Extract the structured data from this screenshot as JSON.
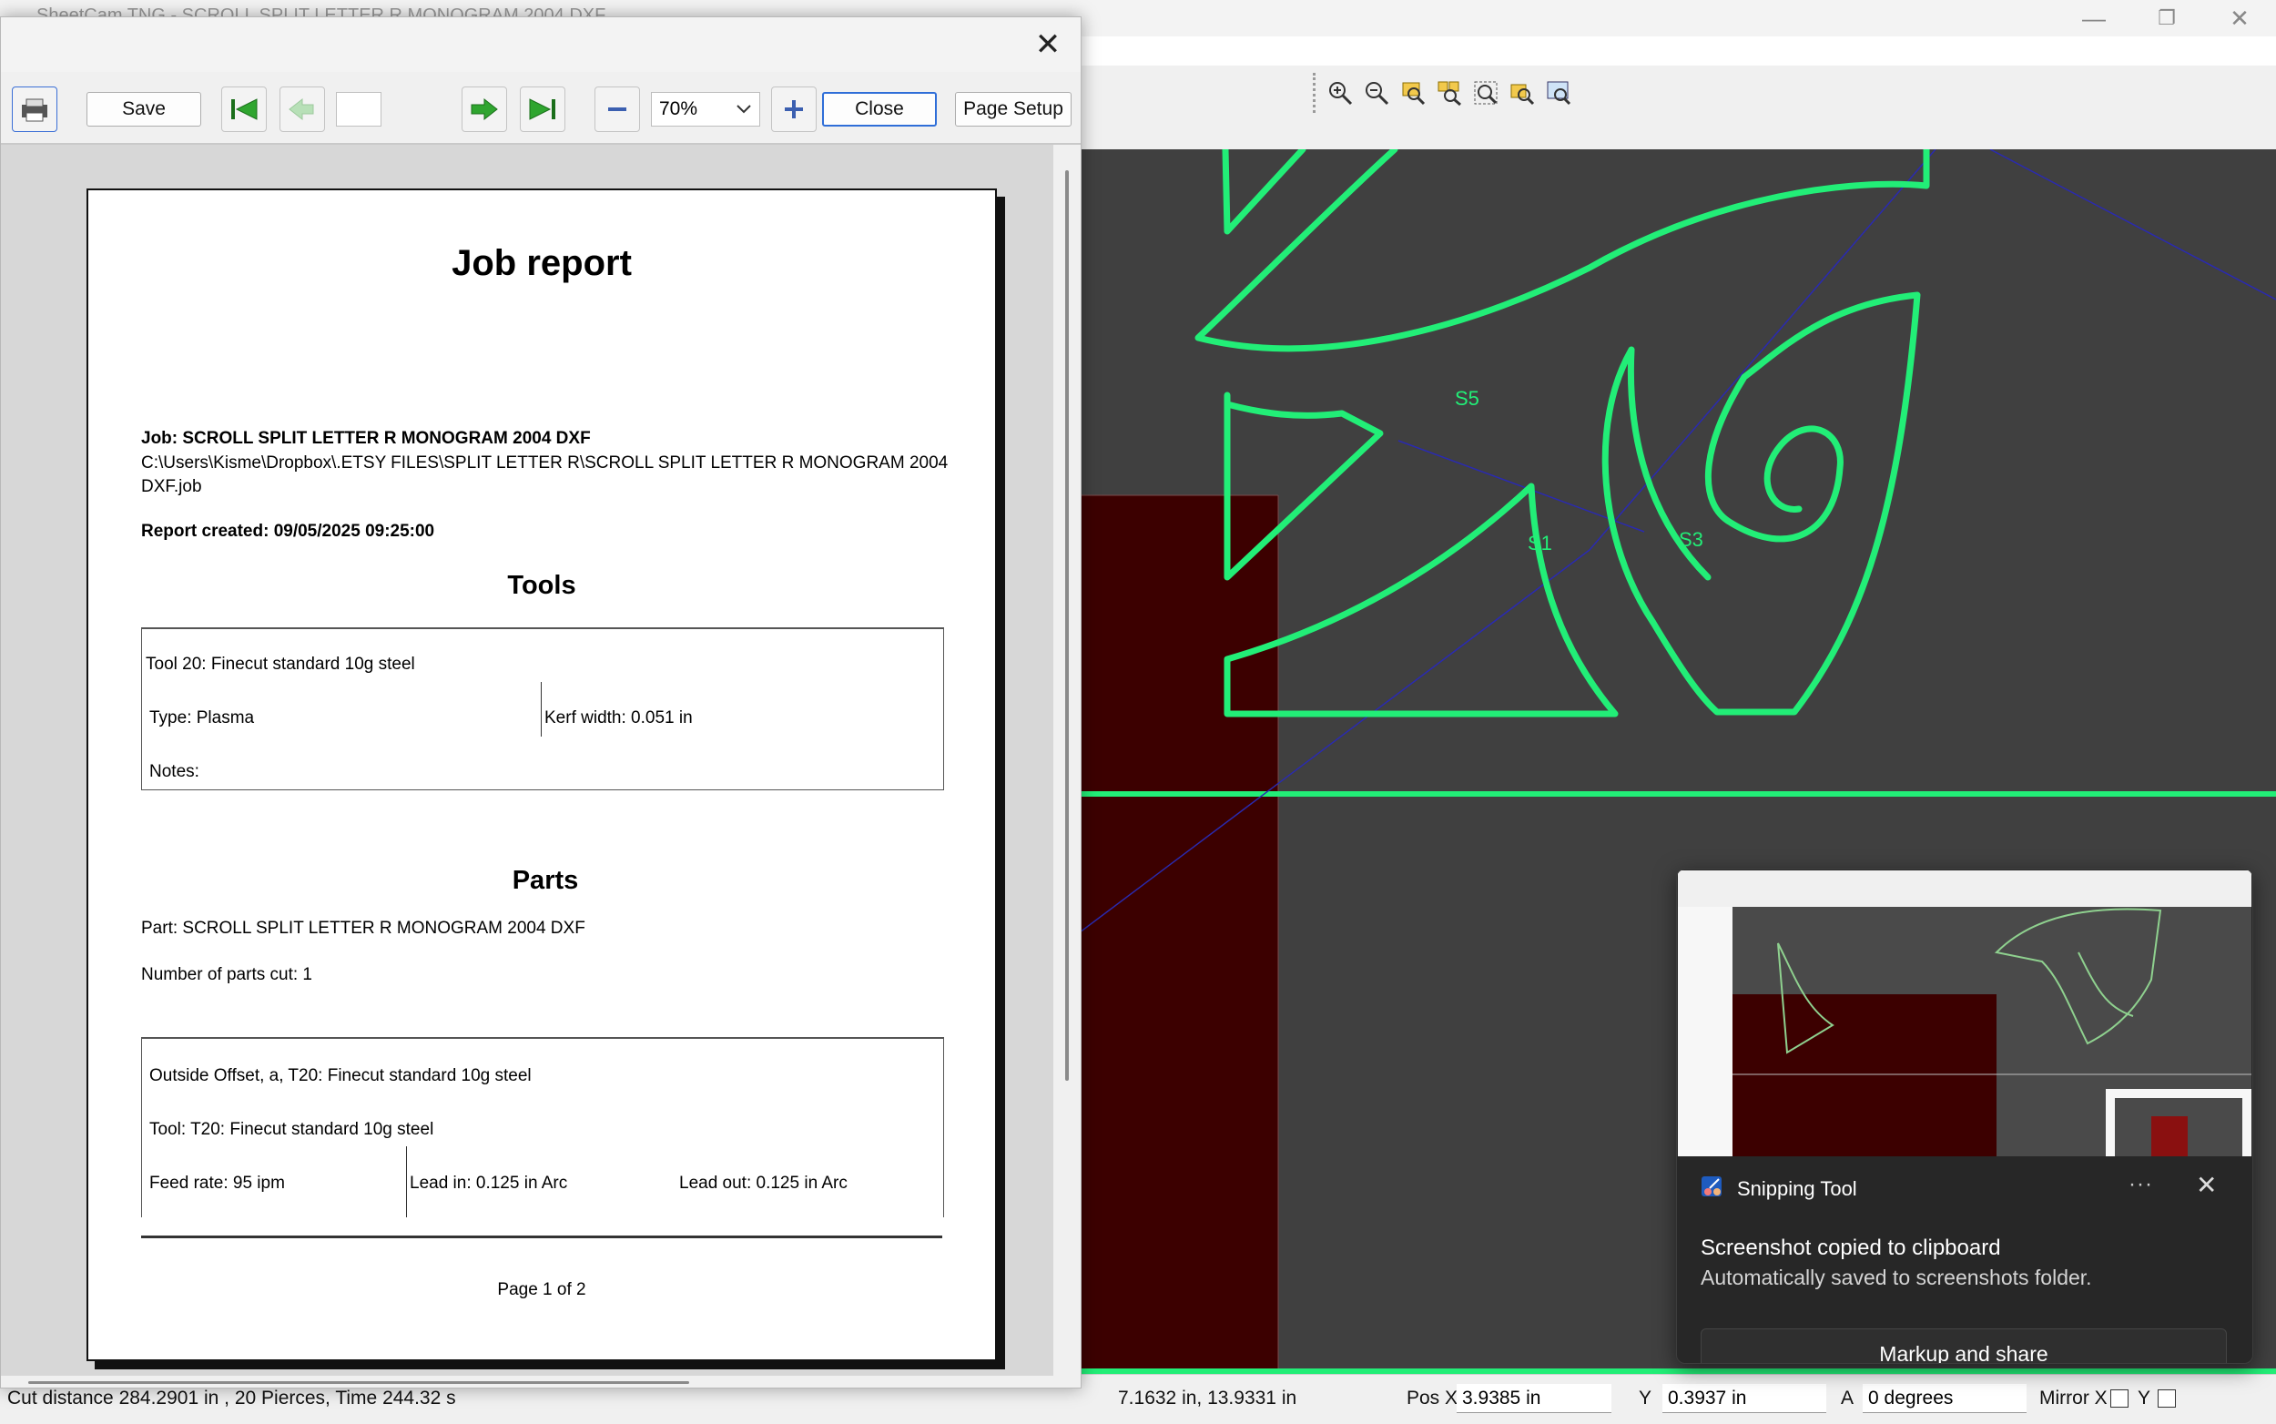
{
  "app": {
    "title": "SheetCam TNG - SCROLL SPLIT LETTER R MONOGRAM 2004 DXF",
    "minimize_glyph": "—",
    "maximize_glyph": "❐",
    "close_glyph": "✕"
  },
  "zoom_tools": [
    "zoom-in-icon",
    "zoom-out-icon",
    "zoom-window-icon",
    "zoom-parts-icon",
    "zoom-fit-icon",
    "zoom-selected-icon",
    "zoom-all-icon"
  ],
  "preview": {
    "close_glyph": "✕",
    "toolbar": {
      "save_label": "Save",
      "page_value": "",
      "zoom_value": "70%",
      "close_label": "Close",
      "page_setup_label": "Page Setup"
    },
    "report": {
      "title": "Job report",
      "job_line": "Job: SCROLL SPLIT LETTER R MONOGRAM 2004 DXF",
      "path_line1": "C:\\Users\\Kisme\\Dropbox\\.ETSY FILES\\SPLIT LETTER R\\SCROLL SPLIT LETTER R MONOGRAM 2004",
      "path_line2": "DXF.job",
      "created": "Report created: 09/05/2025 09:25:00",
      "tools_heading": "Tools",
      "tool_name": "Tool 20: Finecut standard 10g steel",
      "tool_type": "Type: Plasma",
      "kerf": "Kerf width: 0.051 in",
      "notes": "Notes:",
      "parts_heading": "Parts",
      "part_name": "Part: SCROLL SPLIT LETTER R MONOGRAM 2004 DXF",
      "parts_cut": "Number of parts cut: 1",
      "op_name": "Outside Offset, a, T20: Finecut standard 10g steel",
      "op_tool": "Tool: T20: Finecut standard 10g steel",
      "feed": "Feed rate: 95 ipm",
      "lead_in": "Lead in: 0.125 in Arc",
      "lead_out": "Lead out: 0.125 in Arc",
      "page_label": "Page 1 of 2"
    }
  },
  "canvas": {
    "start_labels": [
      "S5",
      "S1",
      "S3"
    ]
  },
  "status": {
    "cut_info": "Cut distance 284.2901 in , 20 Pierces, Time 244.32 s",
    "cursor": "7.1632 in, 13.9331 in",
    "pos_x_label": "Pos X",
    "pos_x_value": "3.9385 in",
    "y_label": "Y",
    "y_value": "0.3937 in",
    "a_label": "A",
    "a_value": "0 degrees",
    "mirror_x_label": "Mirror X",
    "y_mirror_label": "Y"
  },
  "toast": {
    "app_name": "Snipping Tool",
    "more_glyph": "···",
    "close_glyph": "✕",
    "title": "Screenshot copied to clipboard",
    "body": "Automatically saved to screenshots folder.",
    "action_label": "Markup and share"
  },
  "colors": {
    "canvas_bg": "#404040",
    "toolpath_green": "#22ee77",
    "sheet_red": "#3c0000",
    "toast_bg": "#272727"
  }
}
